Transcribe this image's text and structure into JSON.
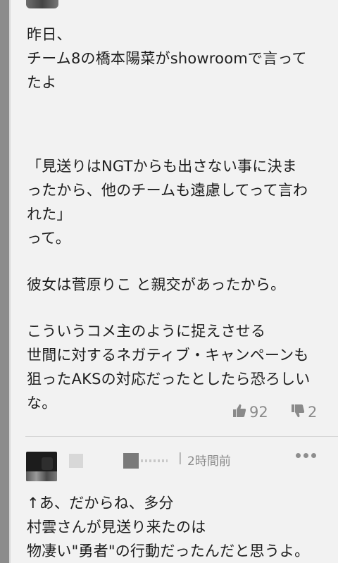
{
  "comment1": {
    "lines": [
      "昨日、",
      "チーム8の橋本陽菜がshowroomで言って",
      "たよ",
      "",
      "",
      "「見送りはNGTからも出さない事に決ま",
      "ったから、他のチームも遠慮してって言わ",
      "れた」",
      "って。",
      "",
      "彼女は菅原りこ と親交があったから。",
      "",
      "こういうコメ主のように捉えさせる",
      "世間に対するネガティブ・キャンペーンも",
      "狙ったAKSの対応だったとしたら恐ろしい",
      "な。"
    ],
    "likes": "92",
    "dislikes": "2"
  },
  "comment2": {
    "separator": "|",
    "timestamp": "2時間前",
    "lines": [
      "↑あ、だからね、多分",
      "村雲さんが見送り来たのは",
      "物凄い\"勇者\"の行動だったんだと思うよ。"
    ]
  },
  "icons": {
    "like": "thumbs-up-icon",
    "dislike": "thumbs-down-icon",
    "more": "more-horizontal-icon"
  }
}
